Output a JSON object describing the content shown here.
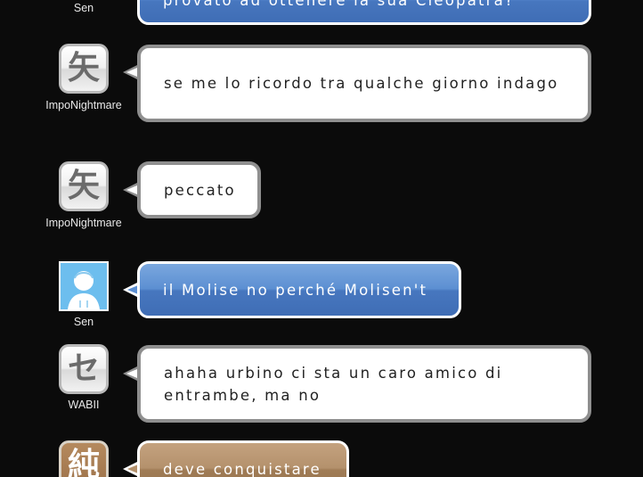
{
  "messages": [
    {
      "user": "Sen",
      "text": "provato ad ottenere la sua Cleopatra?",
      "style": "blue"
    },
    {
      "user": "ImpoNightmare",
      "avatar_glyph": "矢",
      "text": "se me lo ricordo tra qualche giorno indago",
      "style": "white"
    },
    {
      "user": "ImpoNightmare",
      "avatar_glyph": "矢",
      "text": "peccato",
      "style": "white"
    },
    {
      "user": "Sen",
      "text": "il Molise no perché Molisen't",
      "style": "blue"
    },
    {
      "user": "WABII",
      "avatar_glyph": "セ",
      "text": "ahaha urbino ci sta un caro amico di entrambe, ma no",
      "style": "white"
    },
    {
      "user": "",
      "avatar_glyph": "純",
      "text": "deve conquistare",
      "style": "brown"
    }
  ],
  "colors": {
    "background": "#0b0b0b",
    "blue_bubble": "#4f80c8",
    "brown_bubble": "#a88560",
    "white_bubble_border": "#8f8f8f"
  }
}
